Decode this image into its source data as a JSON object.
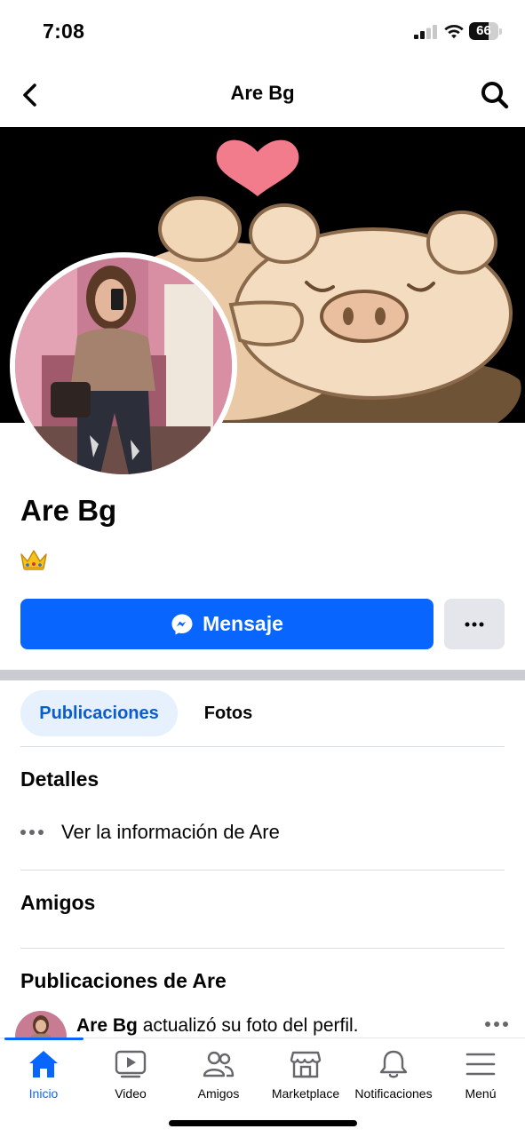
{
  "status_bar": {
    "time": "7:08",
    "battery": "66",
    "battery_level": 0.66
  },
  "nav": {
    "title": "Are Bg"
  },
  "profile": {
    "name": "Are Bg",
    "bio_icon": "crown-emoji"
  },
  "actions": {
    "message_label": "Mensaje"
  },
  "tabs": [
    {
      "label": "Publicaciones",
      "active": true
    },
    {
      "label": "Fotos",
      "active": false
    }
  ],
  "details": {
    "title": "Detalles",
    "info_link": "Ver la información de Are"
  },
  "friends": {
    "title": "Amigos"
  },
  "posts": {
    "title": "Publicaciones de Are",
    "first": {
      "author": "Are Bg",
      "action": "actualizó su foto del perfil."
    }
  },
  "bottom_nav": [
    {
      "label": "Inicio",
      "icon": "home-icon",
      "active": true
    },
    {
      "label": "Video",
      "icon": "video-icon",
      "active": false
    },
    {
      "label": "Amigos",
      "icon": "friends-icon",
      "active": false
    },
    {
      "label": "Marketplace",
      "icon": "marketplace-icon",
      "active": false
    },
    {
      "label": "Notificaciones",
      "icon": "bell-icon",
      "active": false
    },
    {
      "label": "Menú",
      "icon": "menu-icon",
      "active": false
    }
  ],
  "colors": {
    "accent": "#0866ff",
    "tab_active_bg": "#e7f0fd",
    "secondary_button": "#e4e6eb"
  }
}
